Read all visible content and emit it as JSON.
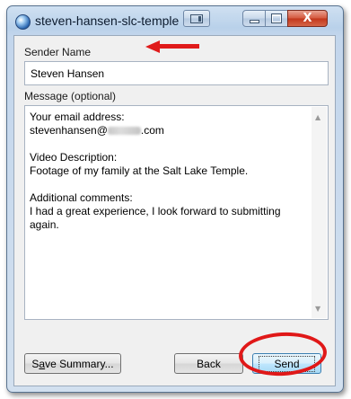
{
  "window": {
    "title": "steven-hansen-slc-temple",
    "close_glyph": "X"
  },
  "form": {
    "sender_label": "Sender Name",
    "sender_value": "Steven Hansen",
    "message_label": "Message (optional)",
    "message_lines": {
      "email_label": "Your email address:",
      "email_prefix": "stevenhansen@",
      "email_suffix": ".com",
      "video_label": "Video Description:",
      "video_value": "Footage of my family at the Salt Lake Temple.",
      "comments_label": "Additional comments:",
      "comments_value": "I had a great experience, I look forward to submitting again."
    }
  },
  "buttons": {
    "save_prefix": "S",
    "save_mnemonic": "a",
    "save_suffix": "ve Summary...",
    "back": "Back",
    "send": "Send"
  },
  "annotation": {
    "color": "#e01b1b",
    "arrow_icon": "red-arrow-icon",
    "circle": "red-circle-highlight"
  }
}
